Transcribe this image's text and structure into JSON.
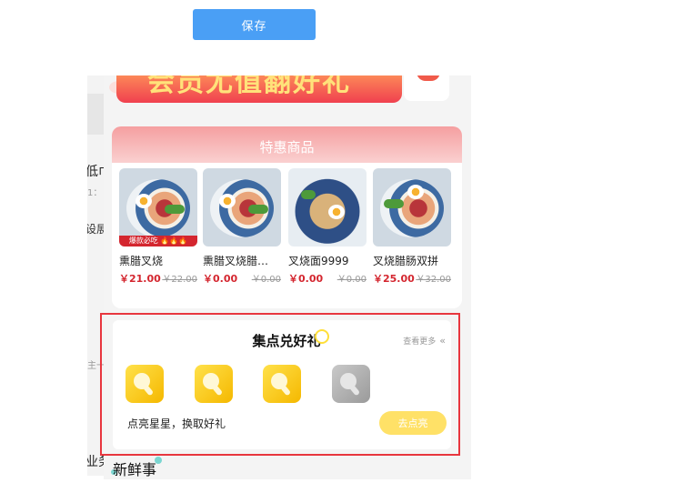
{
  "toolbar": {
    "save_label": "保存"
  },
  "background_editor": {
    "fragments": [
      "低巾",
      "1：",
      "设展",
      "主一",
      "业务"
    ]
  },
  "banner": {
    "text": "会员尤值翻好礼"
  },
  "special": {
    "title": "特惠商品",
    "products": [
      {
        "name": "熏腊叉烧",
        "price": "￥21.00",
        "original_price": "￥22.00",
        "label": "爆款必吃 🔥🔥🔥"
      },
      {
        "name": "熏腊叉烧腊…",
        "price": "￥0.00",
        "original_price": "￥0.00",
        "label": ""
      },
      {
        "name": "叉烧面9999",
        "price": "￥0.00",
        "original_price": "￥0.00",
        "label": ""
      },
      {
        "name": "叉烧腊肠双拼",
        "price": "￥25.00",
        "original_price": "￥32.00",
        "label": ""
      }
    ]
  },
  "collect": {
    "title": "集点兑好礼",
    "more_label": "查看更多",
    "more_icon": "double-chevron-left-icon",
    "stars": [
      {
        "state": "lit",
        "icon": "chicken-leg-icon"
      },
      {
        "state": "lit",
        "icon": "chicken-leg-icon"
      },
      {
        "state": "lit",
        "icon": "chicken-leg-icon"
      },
      {
        "state": "unlit",
        "icon": "chicken-leg-icon"
      }
    ],
    "description": "点亮星星，换取好礼",
    "button_label": "去点亮",
    "colors": {
      "lit": "#f5c400",
      "unlit": "#a9a9a9",
      "highlight_border": "#e8363e"
    }
  },
  "news": {
    "title": "新鲜事"
  }
}
